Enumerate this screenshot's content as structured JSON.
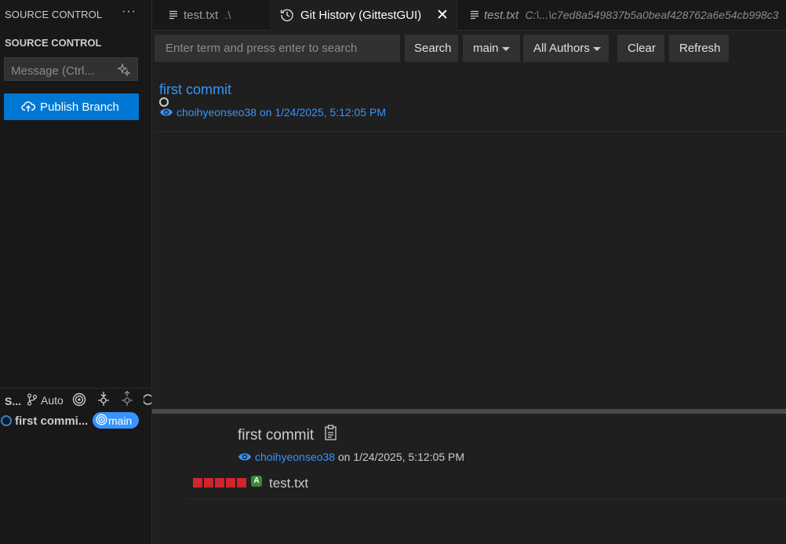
{
  "sidebar": {
    "header": "SOURCE CONTROL",
    "section_title": "SOURCE CONTROL",
    "message_placeholder": "Message (Ctrl...",
    "publish_label": "Publish Branch",
    "graph": {
      "title": "S...",
      "auto_label": "Auto",
      "commit_label": "first commi...",
      "branch": "main"
    }
  },
  "tabs": [
    {
      "label": "test.txt",
      "detail": ".\\",
      "icon": "file-lines-icon"
    },
    {
      "label": "Git History (GittestGUI)",
      "icon": "history-icon",
      "close": "✕"
    },
    {
      "label": "test.txt",
      "detail": "C:\\...\\c7ed8a549837b5a0beaf428762a6e54cb998c3",
      "icon": "file-lines-icon"
    }
  ],
  "toolbar": {
    "search_placeholder": "Enter term and press enter to search",
    "search_label": "Search",
    "branch_label": "main",
    "authors_label": "All Authors",
    "clear_label": "Clear",
    "refresh_label": "Refresh"
  },
  "commits": [
    {
      "message": "first commit",
      "author": "choihyeonseo38",
      "date_text": "on 1/24/2025, 5:12:05 PM"
    }
  ],
  "details": {
    "title": "first commit",
    "author": "choihyeonseo38",
    "date_text": "on 1/24/2025, 5:12:05 PM",
    "files": [
      {
        "status": "A",
        "name": "test.txt"
      }
    ]
  },
  "colors": {
    "accent": "#0078d4",
    "link": "#3794ff",
    "deleted_bar": "#d1242f",
    "added_badge": "#388a34",
    "background": "#1f1f1f",
    "sidebar_background": "#181818"
  }
}
